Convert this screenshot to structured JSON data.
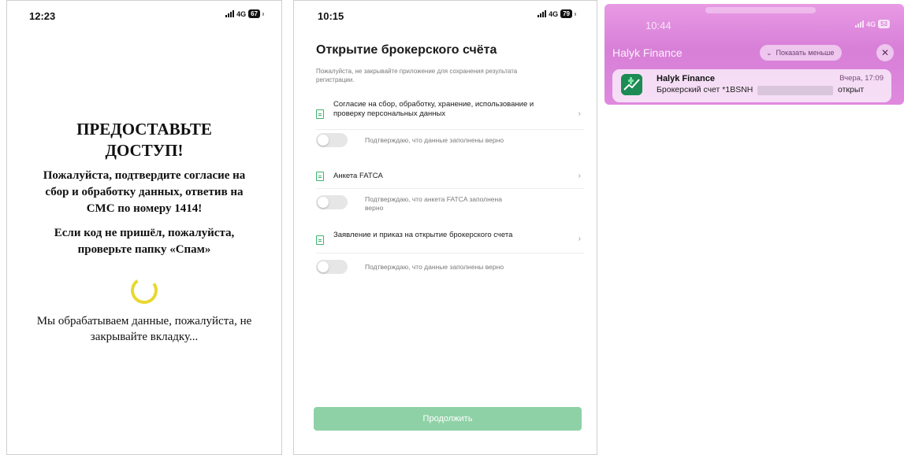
{
  "phone1": {
    "time": "12:23",
    "network": "4G",
    "battery": "67",
    "title": "ПРЕДОСТАВЬТЕ ДОСТУП!",
    "instruction": "Пожалуйста, подтвердите согласие на сбор и обработку данных, ответив на СМС по номеру 1414!",
    "spam_hint": "Если код не пришёл, пожалуйста, проверьте папку «Спам»",
    "status": "Мы обрабатываем данные, пожалуйста, не закрывайте вкладку..."
  },
  "phone2": {
    "time": "10:15",
    "network": "4G",
    "battery": "79",
    "title": "Открытие брокерского счёта",
    "subtitle": "Пожалуйста, не закрывайте приложение для сохранения результата регистрации.",
    "items": [
      {
        "label": "Согласие на сбор, обработку, хранение, использование и проверку персональных данных",
        "confirm": "Подтверждаю, что данные заполнены верно"
      },
      {
        "label": "Анкета FATCA",
        "confirm": "Подтверждаю, что анкета FATCA заполнена верно"
      },
      {
        "label": "Заявление и приказ на открытие брокерского счета",
        "confirm": "Подтверждаю, что данные заполнены верно"
      }
    ],
    "continue_label": "Продолжить",
    "accent_color": "#3bb56a"
  },
  "notification": {
    "time": "10:44",
    "network": "4G",
    "battery": "53",
    "app_name": "Halyk Finance",
    "show_less_label": "Показать меньше",
    "close_label": "✕",
    "card_title": "Halyk Finance",
    "card_time": "Вчера, 17:09",
    "card_body_prefix": "Брокерский счет *1BSNH",
    "card_body_suffix": "открыт"
  }
}
